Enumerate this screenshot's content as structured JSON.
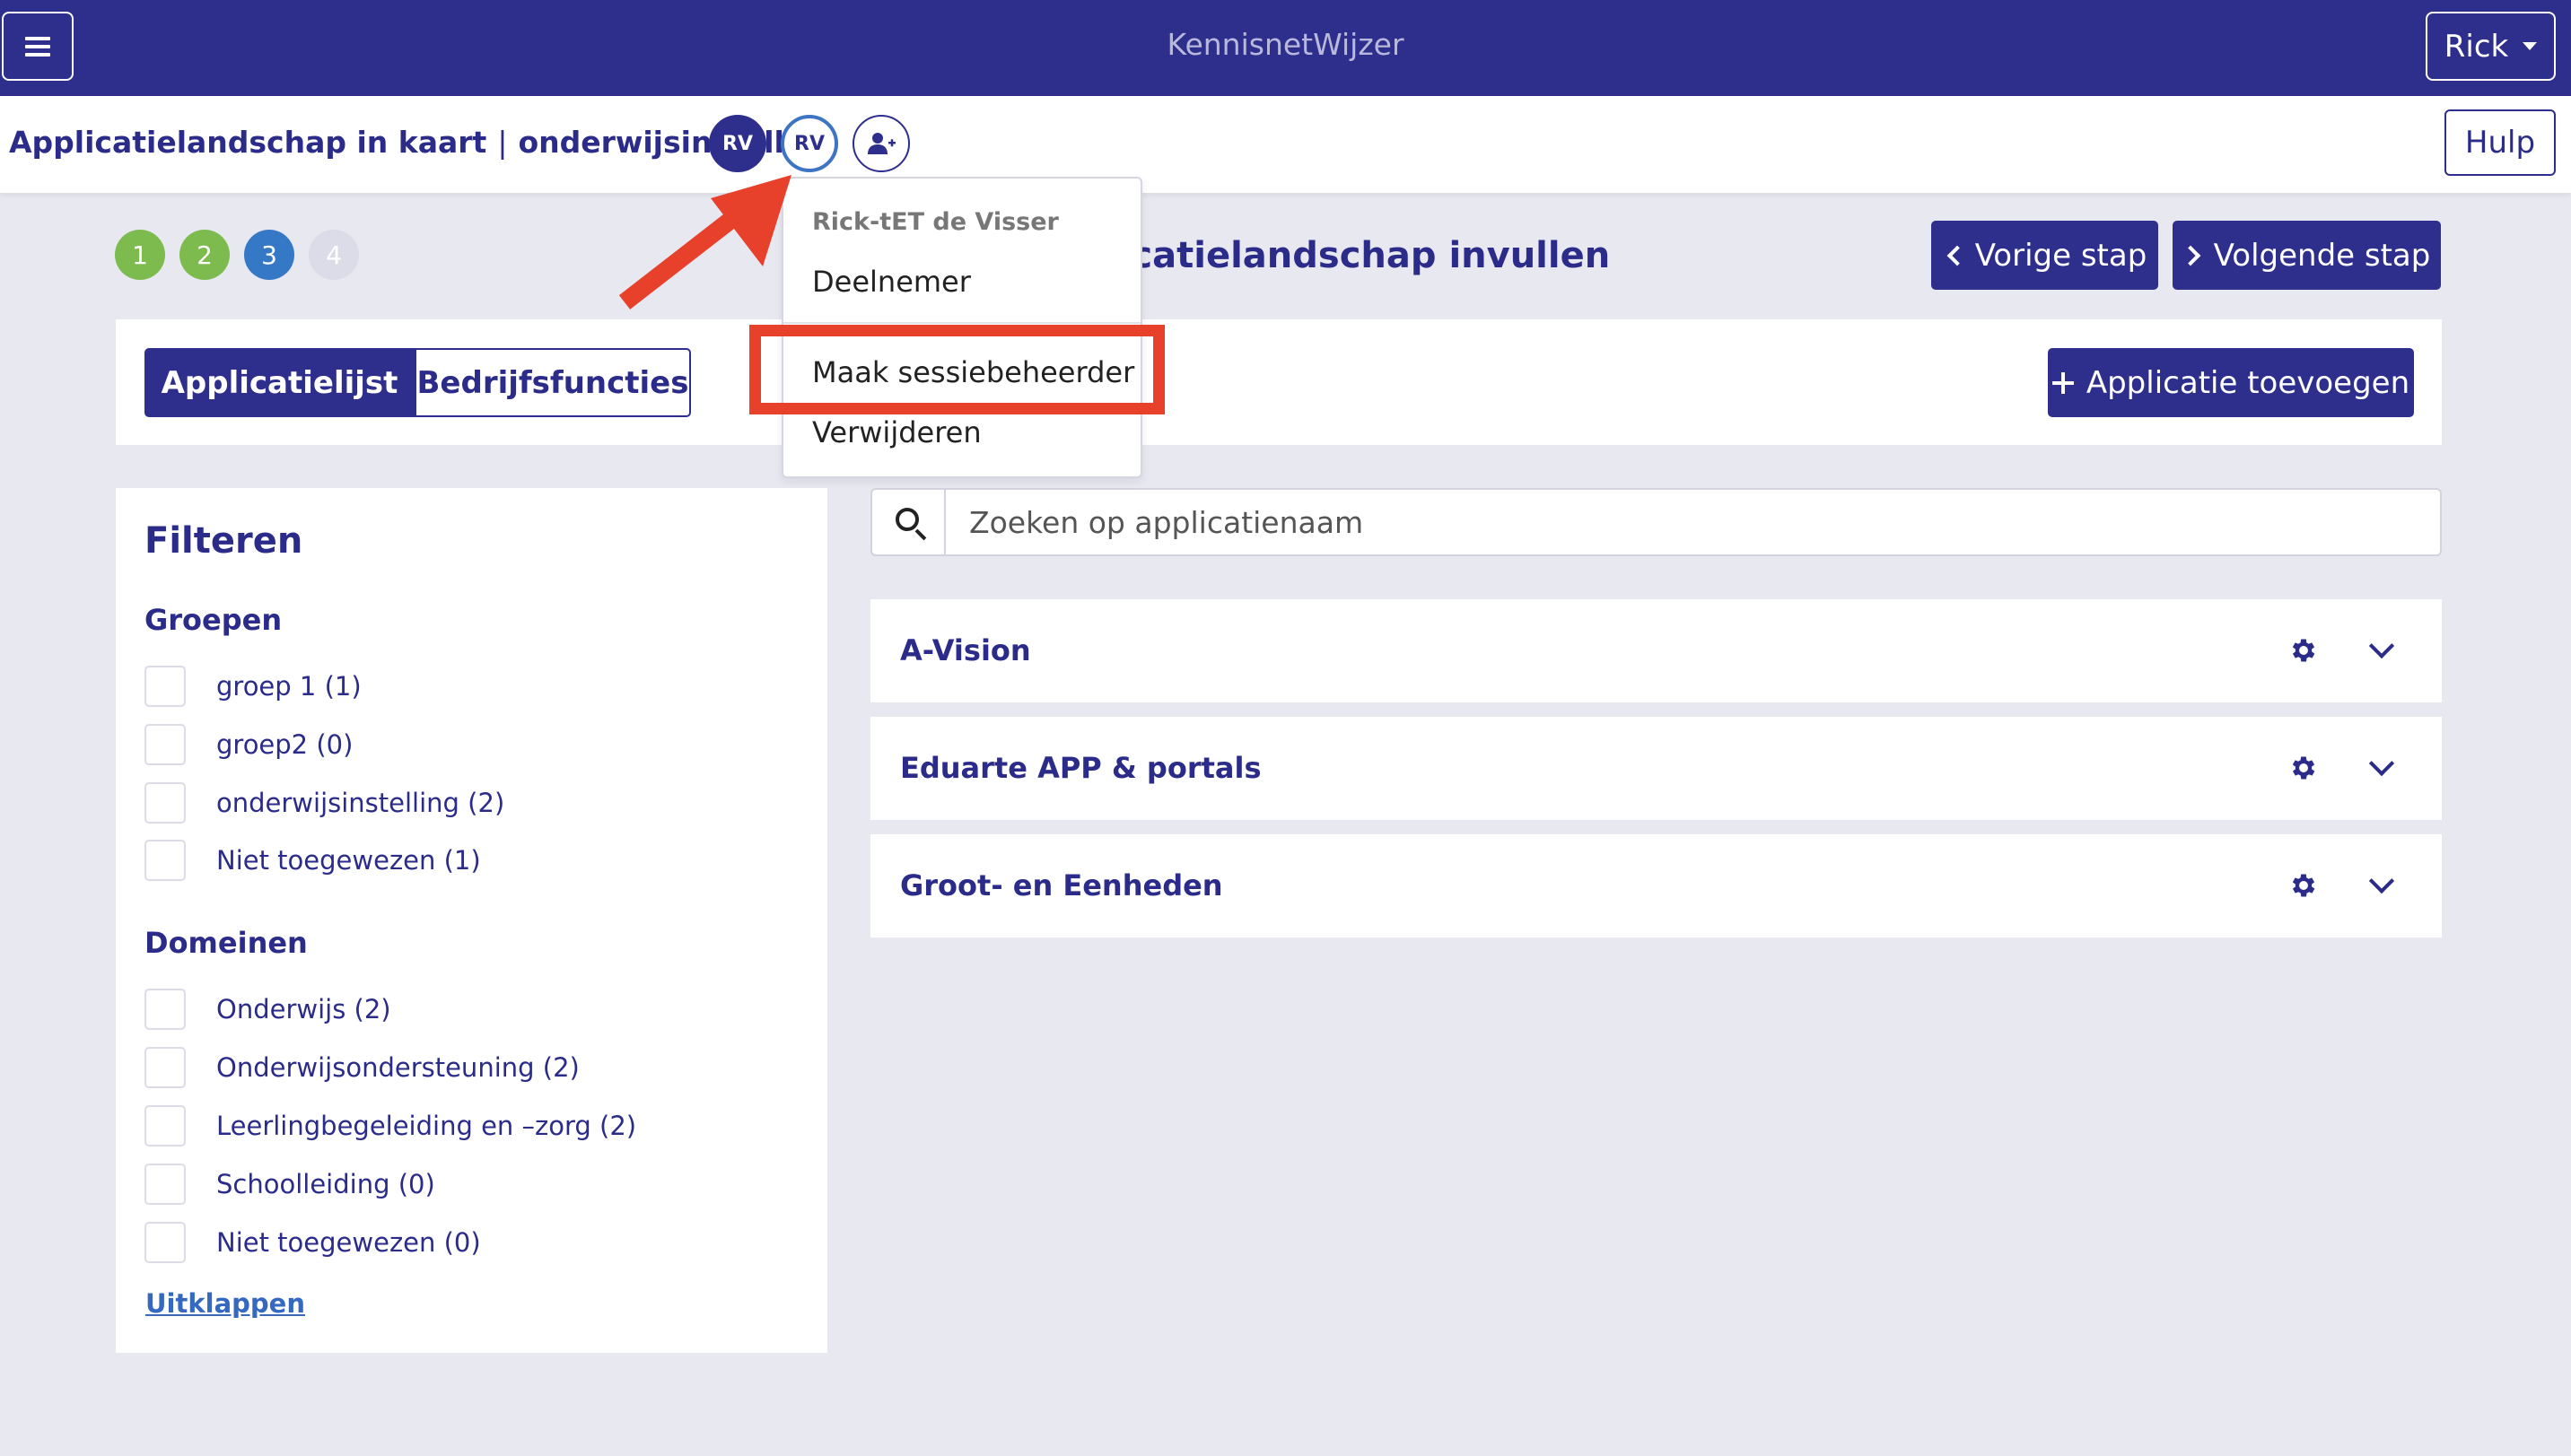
{
  "topbar": {
    "title": "KennisnetWijzer",
    "user_label": "Rick"
  },
  "subheader": {
    "breadcrumb_main": "Applicatielandschap in kaart",
    "breadcrumb_separator": "|",
    "breadcrumb_org": "onderwijsinstelling",
    "avatars": [
      "RV",
      "RV"
    ],
    "help_label": "Hulp"
  },
  "steps": [
    "1",
    "2",
    "3",
    "4"
  ],
  "page_heading": "licatielandschap invullen",
  "nav": {
    "prev_label": "Vorige stap",
    "next_label": "Volgende stap"
  },
  "tabs": {
    "active": "Applicatielijst",
    "inactive": "Bedrijfsfuncties"
  },
  "add_button_label": "Applicatie toevoegen",
  "filter": {
    "title": "Filteren",
    "groups_title": "Groepen",
    "groups": [
      "groep 1 (1)",
      "groep2 (0)",
      "onderwijsinstelling (2)",
      "Niet toegewezen (1)"
    ],
    "domains_title": "Domeinen",
    "domains": [
      "Onderwijs (2)",
      "Onderwijsondersteuning (2)",
      "Leerlingbegeleiding en –zorg (2)",
      "Schoolleiding (0)",
      "Niet toegewezen (0)"
    ],
    "expand_label": "Uitklappen"
  },
  "search": {
    "placeholder": "Zoeken op applicatienaam"
  },
  "apps": [
    "A-Vision",
    "Eduarte APP & portals",
    "Groot- en Eenheden"
  ],
  "dropdown": {
    "header": "Rick-tET de Visser",
    "items": [
      "Deelnemer",
      "Maak sessiebeheerder",
      "Verwijderen"
    ]
  },
  "colors": {
    "primary": "#2e2e8c",
    "step_done": "#7dbb4f",
    "step_current": "#3578c6",
    "annotation": "#e7412c"
  }
}
